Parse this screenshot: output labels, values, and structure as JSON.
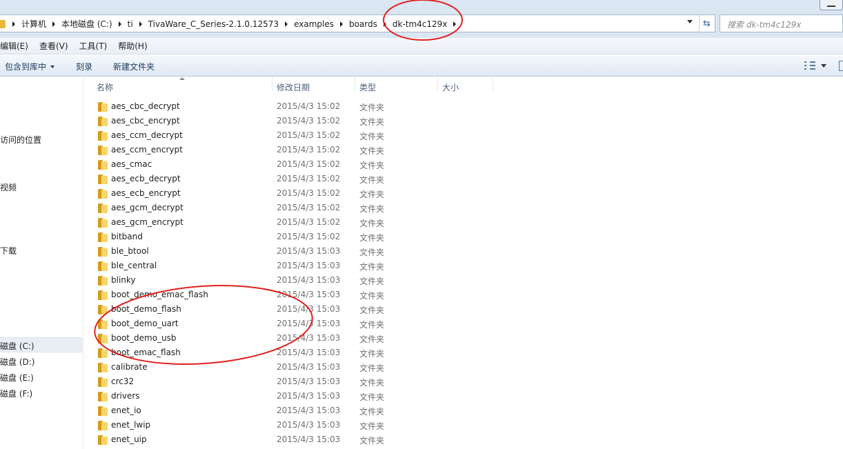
{
  "address_bar": {
    "breadcrumbs": [
      "计算机",
      "本地磁盘 (C:)",
      "ti",
      "TivaWare_C_Series-2.1.0.12573",
      "examples",
      "boards",
      "dk-tm4c129x"
    ]
  },
  "search": {
    "placeholder": "搜索 dk-tm4c129x"
  },
  "menu": [
    "编辑(E)",
    "查看(V)",
    "工具(T)",
    "帮助(H)"
  ],
  "toolbar": {
    "include_library": "包含到库中",
    "burn": "刻录",
    "new_folder": "新建文件夹"
  },
  "nav": {
    "recent_places": "访问的位置",
    "videos": "视频",
    "downloads": "下载",
    "drives": [
      "磁盘 (C:)",
      "磁盘 (D:)",
      "磁盘 (E:)",
      "磁盘 (F:)"
    ]
  },
  "columns": {
    "name": "名称",
    "date": "修改日期",
    "type": "类型",
    "size": "大小"
  },
  "files": [
    {
      "name": "aes_cbc_decrypt",
      "date": "2015/4/3 15:02",
      "type": "文件夹"
    },
    {
      "name": "aes_cbc_encrypt",
      "date": "2015/4/3 15:02",
      "type": "文件夹"
    },
    {
      "name": "aes_ccm_decrypt",
      "date": "2015/4/3 15:02",
      "type": "文件夹"
    },
    {
      "name": "aes_ccm_encrypt",
      "date": "2015/4/3 15:02",
      "type": "文件夹"
    },
    {
      "name": "aes_cmac",
      "date": "2015/4/3 15:02",
      "type": "文件夹"
    },
    {
      "name": "aes_ecb_decrypt",
      "date": "2015/4/3 15:02",
      "type": "文件夹"
    },
    {
      "name": "aes_ecb_encrypt",
      "date": "2015/4/3 15:02",
      "type": "文件夹"
    },
    {
      "name": "aes_gcm_decrypt",
      "date": "2015/4/3 15:02",
      "type": "文件夹"
    },
    {
      "name": "aes_gcm_encrypt",
      "date": "2015/4/3 15:02",
      "type": "文件夹"
    },
    {
      "name": "bitband",
      "date": "2015/4/3 15:02",
      "type": "文件夹"
    },
    {
      "name": "ble_btool",
      "date": "2015/4/3 15:03",
      "type": "文件夹"
    },
    {
      "name": "ble_central",
      "date": "2015/4/3 15:03",
      "type": "文件夹"
    },
    {
      "name": "blinky",
      "date": "2015/4/3 15:03",
      "type": "文件夹"
    },
    {
      "name": "boot_demo_emac_flash",
      "date": "2015/4/3 15:03",
      "type": "文件夹"
    },
    {
      "name": "boot_demo_flash",
      "date": "2015/4/3 15:03",
      "type": "文件夹"
    },
    {
      "name": "boot_demo_uart",
      "date": "2015/4/3 15:03",
      "type": "文件夹"
    },
    {
      "name": "boot_demo_usb",
      "date": "2015/4/3 15:03",
      "type": "文件夹"
    },
    {
      "name": "boot_emac_flash",
      "date": "2015/4/3 15:03",
      "type": "文件夹"
    },
    {
      "name": "calibrate",
      "date": "2015/4/3 15:03",
      "type": "文件夹"
    },
    {
      "name": "crc32",
      "date": "2015/4/3 15:03",
      "type": "文件夹"
    },
    {
      "name": "drivers",
      "date": "2015/4/3 15:03",
      "type": "文件夹"
    },
    {
      "name": "enet_io",
      "date": "2015/4/3 15:03",
      "type": "文件夹"
    },
    {
      "name": "enet_lwip",
      "date": "2015/4/3 15:03",
      "type": "文件夹"
    },
    {
      "name": "enet_uip",
      "date": "2015/4/3 15:03",
      "type": "文件夹"
    }
  ],
  "colors": {
    "annotation": "#e0201c",
    "folder": "#f7d56b",
    "chrome": "#dbe6f3"
  },
  "icons": [
    "folder-icon",
    "refresh-icon",
    "view-options-icon",
    "preview-pane-icon",
    "dropdown-icon",
    "sort-arrow-icon"
  ]
}
